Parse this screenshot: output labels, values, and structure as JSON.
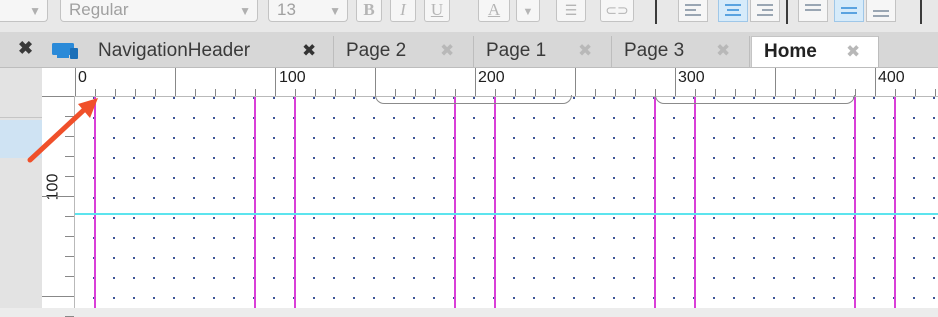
{
  "toolbar": {
    "font_style": "Regular",
    "font_size": "13",
    "bold_label": "B",
    "italic_label": "I",
    "underline_label": "U",
    "text_color_label": "A"
  },
  "tabs": [
    {
      "label": "NavigationHeader",
      "close": "✖"
    },
    {
      "label": "Page 2",
      "close": "✖"
    },
    {
      "label": "Page 1",
      "close": "✖"
    },
    {
      "label": "Page 3",
      "close": "✖"
    },
    {
      "label": "Home",
      "close": "✖"
    }
  ],
  "active_tab": "Home",
  "panel_close": "✖",
  "ruler": {
    "top_labels": [
      "0",
      "100",
      "200",
      "300",
      "400"
    ],
    "left_labels": [
      "100"
    ]
  },
  "colors": {
    "guide_vertical": "#d93fd8",
    "guide_horizontal": "#5ce4ee",
    "annotation_arrow": "#f0502a",
    "selection": "#d6ebfa"
  },
  "icons": [
    "device-preview-icon",
    "underline-icon",
    "text-color-icon",
    "list-icon",
    "link-icon",
    "align-left-icon",
    "align-center-icon",
    "align-right-icon",
    "valign-top-icon",
    "valign-middle-icon",
    "valign-bottom-icon",
    "close-icon",
    "annotation-arrow-icon"
  ]
}
